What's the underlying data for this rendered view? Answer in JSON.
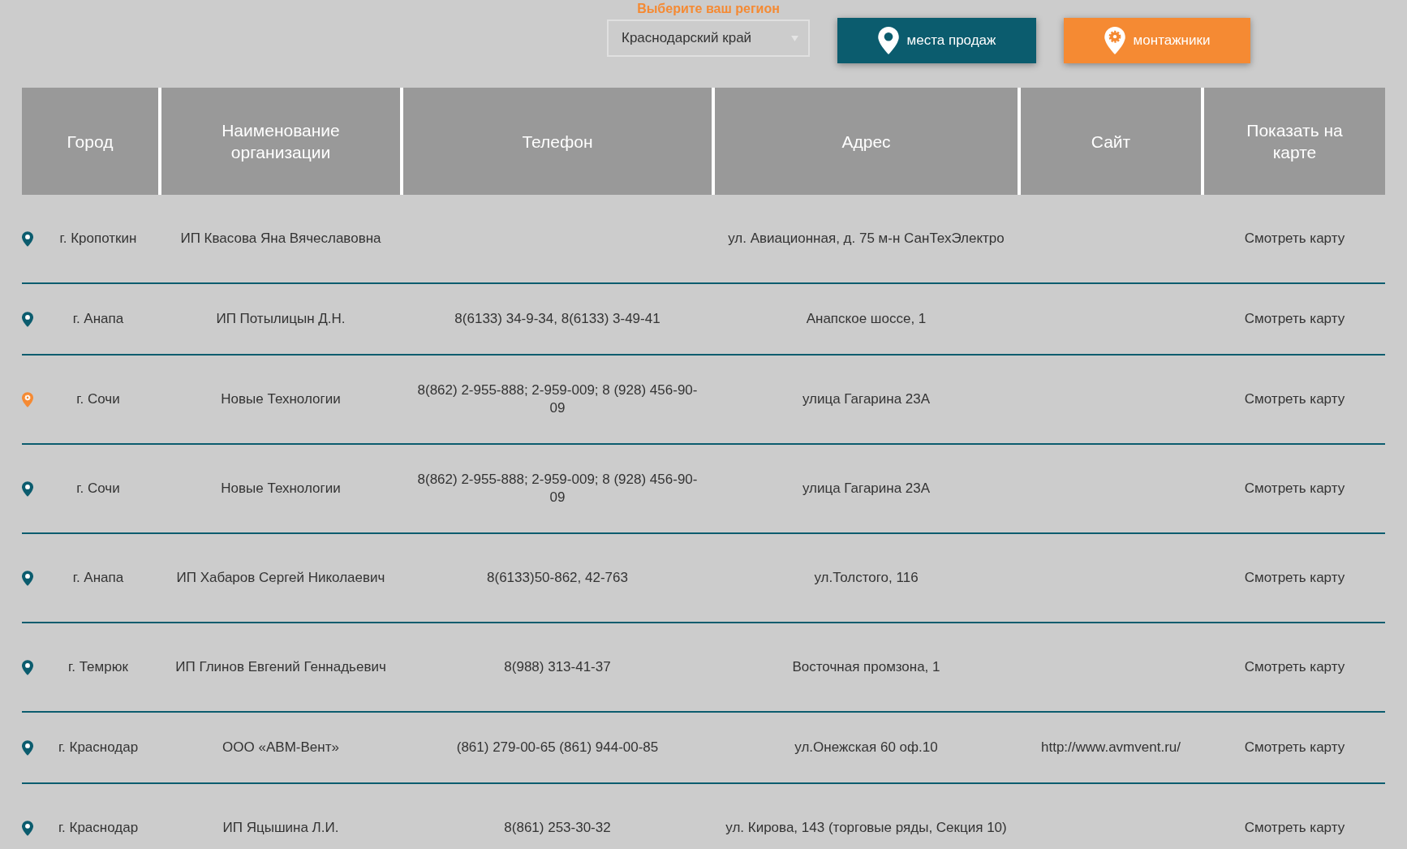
{
  "region": {
    "label": "Выберите ваш регион",
    "value": "Краснодарский край"
  },
  "buttons": [
    {
      "label": "места продаж",
      "kind": "sales"
    },
    {
      "label": "монтажники",
      "kind": "installer"
    }
  ],
  "table": {
    "columns": [
      "Город",
      "Наименование организации",
      "Телефон",
      "Адрес",
      "Сайт",
      "Показать на карте"
    ],
    "rows": [
      {
        "kind": "sales",
        "city": "г. Кропоткин",
        "name": "ИП Квасова Яна Вячеславовна",
        "phone": "",
        "address": "ул. Авиационная, д. 75 м-н СанТехЭлектро",
        "site": "",
        "map": "Смотреть карту"
      },
      {
        "kind": "sales",
        "city": "г. Анапа",
        "name": "ИП Потылицын Д.Н.",
        "phone": "8(6133) 34-9-34, 8(6133) 3-49-41",
        "address": "Анапское шоссе, 1",
        "site": "",
        "map": "Смотреть карту"
      },
      {
        "kind": "installer",
        "city": "г. Сочи",
        "name": "Новые Технологии",
        "phone": "8(862) 2-955-888; 2-959-009; 8 (928) 456-90-09",
        "address": "улица Гагарина 23А",
        "site": "",
        "map": "Смотреть карту"
      },
      {
        "kind": "sales",
        "city": "г. Сочи",
        "name": "Новые Технологии",
        "phone": "8(862) 2-955-888; 2-959-009; 8 (928) 456-90-09",
        "address": "улица Гагарина 23А",
        "site": "",
        "map": "Смотреть карту"
      },
      {
        "kind": "sales",
        "city": "г. Анапа",
        "name": "ИП Хабаров Сергей Николаевич",
        "phone": "8(6133)50-862, 42-763",
        "address": "ул.Толстого, 116",
        "site": "",
        "map": "Смотреть карту"
      },
      {
        "kind": "sales",
        "city": "г. Темрюк",
        "name": "ИП Глинов Евгений Геннадьевич",
        "phone": "8(988) 313-41-37",
        "address": "Восточная промзона, 1",
        "site": "",
        "map": "Смотреть карту"
      },
      {
        "kind": "sales",
        "city": "г. Краснодар",
        "name": "ООО «АВМ-Вент»",
        "phone": "(861) 279-00-65 (861) 944-00-85",
        "address": "ул.Онежская 60 оф.10",
        "site": "http://www.avmvent.ru/",
        "map": "Смотреть карту"
      },
      {
        "kind": "sales",
        "city": "г. Краснодар",
        "name": "ИП Яцышина Л.И.",
        "phone": "8(861) 253-30-32",
        "address": "ул. Кирова, 143 (торговые ряды, Секция 10)",
        "site": "",
        "map": "Смотреть карту"
      }
    ]
  }
}
